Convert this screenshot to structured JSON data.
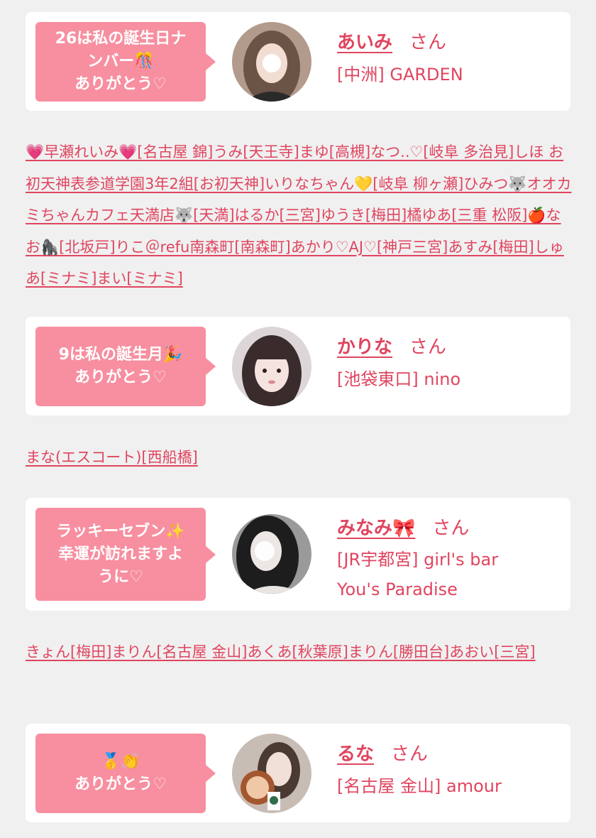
{
  "entries": [
    {
      "bubble": [
        "26は私の誕生日ナ",
        "ンバー🎊",
        "ありがとう"
      ],
      "heart": "♡",
      "name": "あいみ",
      "honorific": "さん",
      "shop": [
        "[中洲] GARDEN"
      ],
      "avatar_colors": [
        "#b29a8c",
        "#6b5346",
        "#f2ddd3"
      ]
    },
    {
      "bubble": [
        "9は私の誕生月🎉",
        "ありがとう"
      ],
      "heart": "♡",
      "name": "かりな",
      "honorific": "さん",
      "shop": [
        "[池袋東口] nino"
      ],
      "avatar_colors": [
        "#dcd6d8",
        "#3a2c2c",
        "#f5e3e0"
      ]
    },
    {
      "bubble": [
        "ラッキーセブン✨",
        "幸運が訪れますよ",
        "うに"
      ],
      "heart": "♡",
      "name": "みなみ🎀",
      "honorific": "さん",
      "shop": [
        "[JR宇都宮] girl's bar",
        "You's Paradise"
      ],
      "avatar_colors": [
        "#9a9a9a",
        "#1d1d1d",
        "#ece6e4"
      ]
    },
    {
      "bubble": [
        "🥇👏",
        "ありがとう"
      ],
      "heart": "♡",
      "name": "るな",
      "honorific": "さん",
      "shop": [
        "[名古屋 金山] amour"
      ],
      "avatar_colors": [
        "#c8bdb5",
        "#4a3a32",
        "#a4562f"
      ]
    }
  ],
  "link_blocks": [
    [
      "💗早瀬れいみ💗[名古屋 錦]",
      "うみ[天王寺]",
      "まゆ[高槻]",
      "なつ..♡[岐阜 多治見]",
      "しほ お初天神表参道学園3年2組[お初天神]",
      "いりなちゃん💛[岐阜 柳ヶ瀬]",
      "ひみつ🐺オオカミちゃんカフェ天満店🐺[天満]",
      "はるか[三宮]",
      "ゆうき[梅田]",
      "橘ゆあ[三重 松阪]",
      "🍎なお🦍[北坂戸]",
      "りこ＠refu南森町[南森町]",
      "あかり♡AJ♡[神戸三宮]",
      "あすみ[梅田]",
      "しゅあ[ミナミ]",
      "まい[ミナミ]"
    ],
    [
      "まな(エスコート)[西船橋]"
    ],
    [
      "きょん[梅田]",
      "まりん[名古屋 金山]",
      "あくあ[秋葉原]",
      "まりん[勝田台]",
      "あおい[三宮]"
    ]
  ],
  "colors": {
    "accent": "#e0455f",
    "bubble": "#f78fa0",
    "background": "#f0f0f0",
    "card": "#ffffff"
  }
}
